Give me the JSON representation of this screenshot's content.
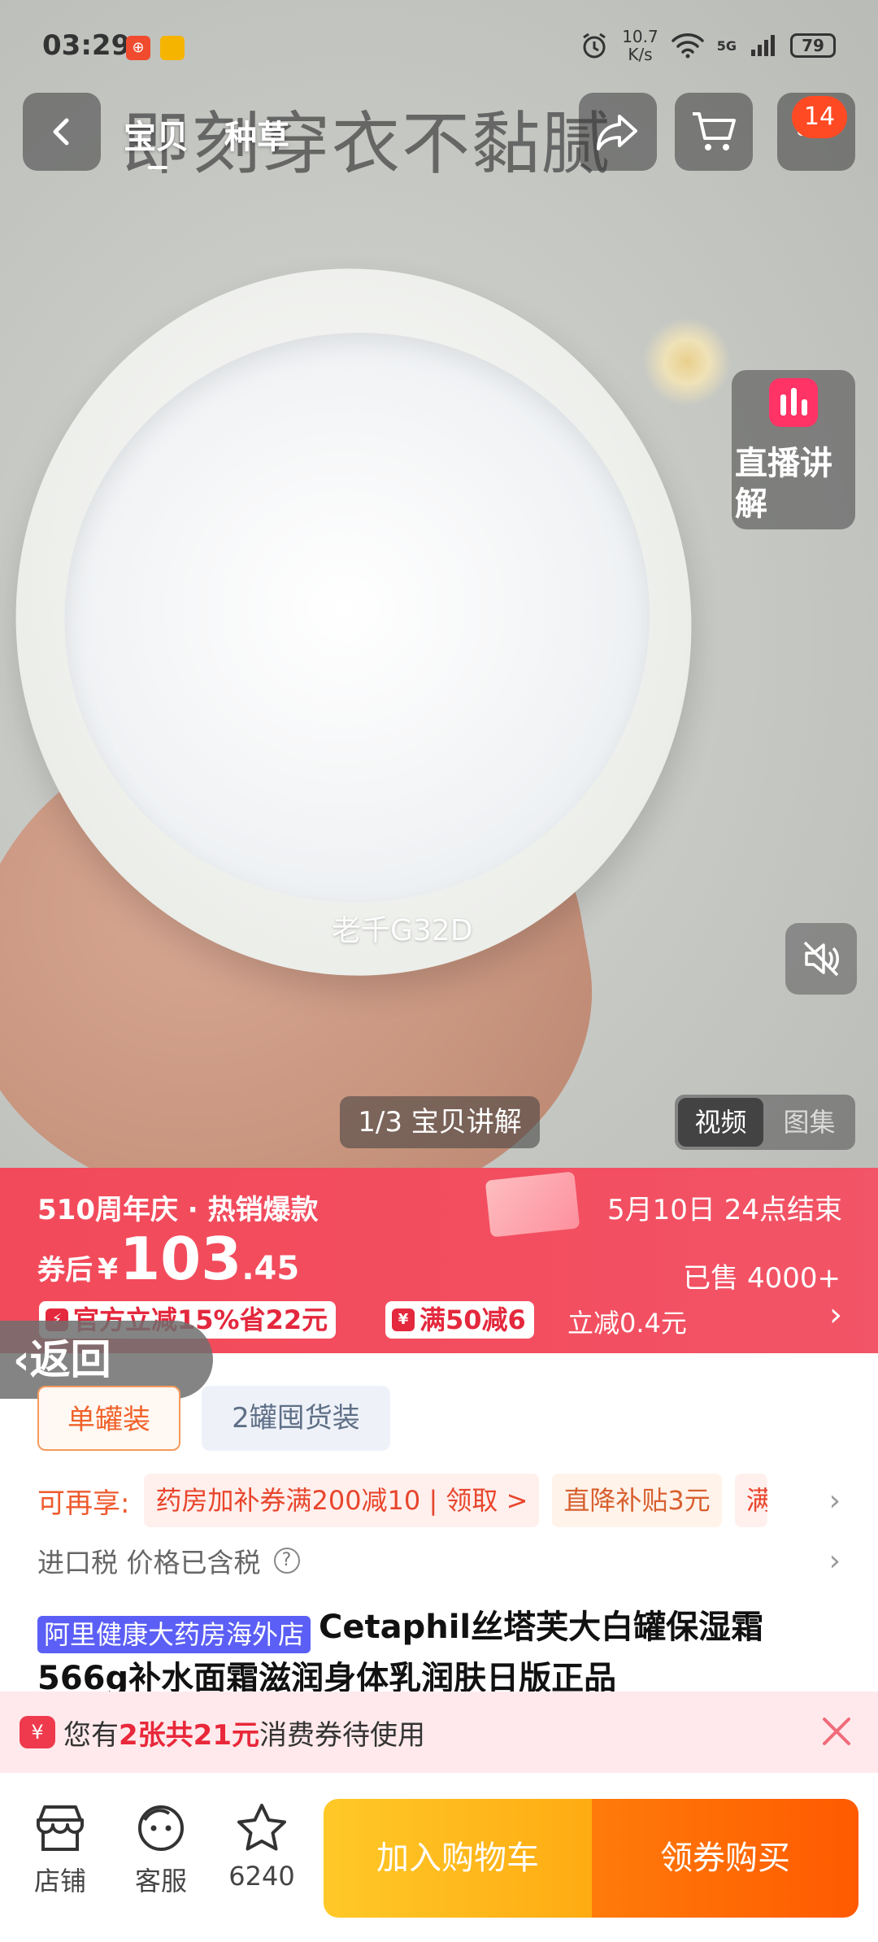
{
  "status_bar": {
    "time": "03:29",
    "network_speed_value": "10.7",
    "network_speed_unit": "K/s",
    "signal_label": "5G",
    "battery": "79"
  },
  "top_bar": {
    "tabs": [
      "宝贝",
      "种草"
    ],
    "cart_badge": "14"
  },
  "hero": {
    "caption_text": "即刻穿衣不黏腻",
    "watermark": "老千G32D",
    "live_explain_label": "直播讲解",
    "explain_pill": "1/3 宝贝讲解",
    "media_tabs": [
      "视频",
      "图集"
    ],
    "active_media_tab": "视频"
  },
  "promo": {
    "title": "510周年庆 · 热销爆款",
    "end_time": "5月10日 24点结束",
    "price_label": "券后",
    "currency": "¥",
    "price_integer": "103",
    "price_decimal": ".45",
    "sold": "已售 4000+",
    "chip1": "官方立减15%省22元",
    "chip2": "满50减6",
    "sub_discount": "立减0.4元",
    "accent_color": "#f24a5a"
  },
  "float_back": "返回",
  "options": [
    "单罐装",
    "2罐囤货装"
  ],
  "enjoy": {
    "label": "可再享:",
    "tag1": "药房加补券满200减10 | 领取 >",
    "tag2": "直降补贴3元",
    "tag3": "满"
  },
  "tax": {
    "text": "进口税 价格已含税",
    "help": "?"
  },
  "product": {
    "store_tag": "阿里健康大药房海外店",
    "title": "Cetaphil丝塔芙大白罐保湿霜566g补水面霜滋润身体乳润肤日版正品"
  },
  "coupon_bar": {
    "prefix": "您有",
    "highlight": "2张共21元",
    "suffix": "消费券待使用",
    "icon": "¥"
  },
  "bottom_bar": {
    "store": "店铺",
    "service": "客服",
    "favorites": "6240",
    "add_to_cart": "加入购物车",
    "buy_with_coupon": "领券购买"
  }
}
